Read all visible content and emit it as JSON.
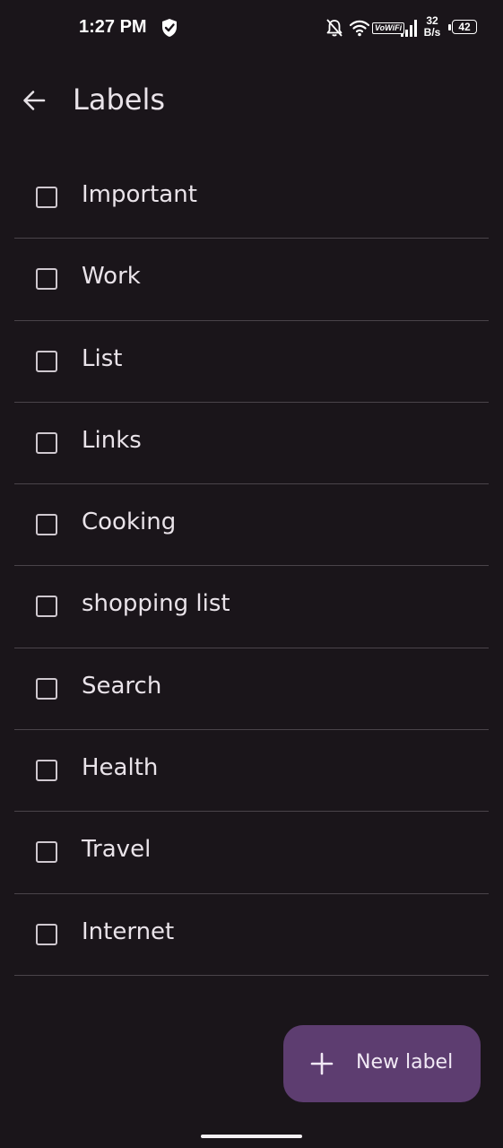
{
  "status_bar": {
    "time": "1:27 PM",
    "vowifi": "VoWiFi",
    "net_speed_value": "32",
    "net_speed_unit": "B/s",
    "battery": "42"
  },
  "header": {
    "title": "Labels"
  },
  "labels": [
    {
      "name": "Important",
      "checked": false
    },
    {
      "name": "Work",
      "checked": false
    },
    {
      "name": "List",
      "checked": false
    },
    {
      "name": "Links",
      "checked": false
    },
    {
      "name": "Cooking",
      "checked": false
    },
    {
      "name": "shopping list",
      "checked": false
    },
    {
      "name": "Search",
      "checked": false
    },
    {
      "name": "Health",
      "checked": false
    },
    {
      "name": "Travel",
      "checked": false
    },
    {
      "name": "Internet",
      "checked": false
    }
  ],
  "fab": {
    "label": "New label",
    "icon": "plus-icon"
  },
  "colors": {
    "background": "#1a151a",
    "fab_background": "#5d3d70",
    "divider": "#4a444a",
    "text": "#e9e3e9"
  }
}
